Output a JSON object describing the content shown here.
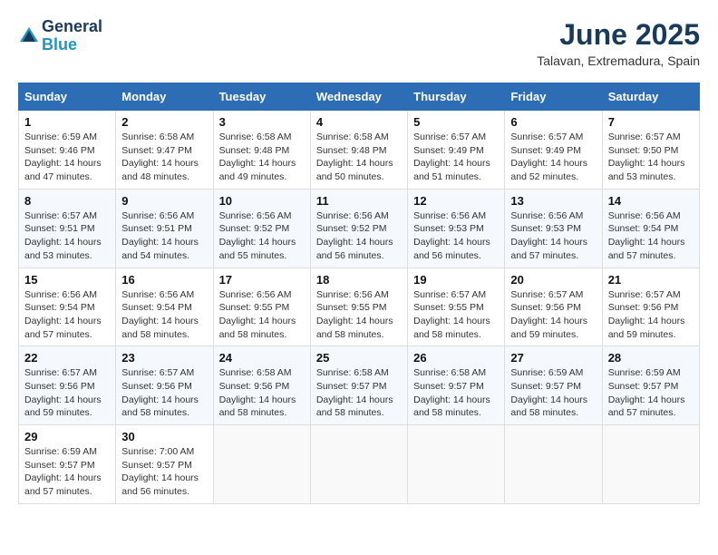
{
  "header": {
    "logo_line1": "General",
    "logo_line2": "Blue",
    "month_year": "June 2025",
    "location": "Talavan, Extremadura, Spain"
  },
  "calendar": {
    "days_of_week": [
      "Sunday",
      "Monday",
      "Tuesday",
      "Wednesday",
      "Thursday",
      "Friday",
      "Saturday"
    ],
    "weeks": [
      [
        {
          "day": "1",
          "sunrise": "6:59 AM",
          "sunset": "9:46 PM",
          "daylight": "14 hours and 47 minutes."
        },
        {
          "day": "2",
          "sunrise": "6:58 AM",
          "sunset": "9:47 PM",
          "daylight": "14 hours and 48 minutes."
        },
        {
          "day": "3",
          "sunrise": "6:58 AM",
          "sunset": "9:48 PM",
          "daylight": "14 hours and 49 minutes."
        },
        {
          "day": "4",
          "sunrise": "6:58 AM",
          "sunset": "9:48 PM",
          "daylight": "14 hours and 50 minutes."
        },
        {
          "day": "5",
          "sunrise": "6:57 AM",
          "sunset": "9:49 PM",
          "daylight": "14 hours and 51 minutes."
        },
        {
          "day": "6",
          "sunrise": "6:57 AM",
          "sunset": "9:49 PM",
          "daylight": "14 hours and 52 minutes."
        },
        {
          "day": "7",
          "sunrise": "6:57 AM",
          "sunset": "9:50 PM",
          "daylight": "14 hours and 53 minutes."
        }
      ],
      [
        {
          "day": "8",
          "sunrise": "6:57 AM",
          "sunset": "9:51 PM",
          "daylight": "14 hours and 53 minutes."
        },
        {
          "day": "9",
          "sunrise": "6:56 AM",
          "sunset": "9:51 PM",
          "daylight": "14 hours and 54 minutes."
        },
        {
          "day": "10",
          "sunrise": "6:56 AM",
          "sunset": "9:52 PM",
          "daylight": "14 hours and 55 minutes."
        },
        {
          "day": "11",
          "sunrise": "6:56 AM",
          "sunset": "9:52 PM",
          "daylight": "14 hours and 56 minutes."
        },
        {
          "day": "12",
          "sunrise": "6:56 AM",
          "sunset": "9:53 PM",
          "daylight": "14 hours and 56 minutes."
        },
        {
          "day": "13",
          "sunrise": "6:56 AM",
          "sunset": "9:53 PM",
          "daylight": "14 hours and 57 minutes."
        },
        {
          "day": "14",
          "sunrise": "6:56 AM",
          "sunset": "9:54 PM",
          "daylight": "14 hours and 57 minutes."
        }
      ],
      [
        {
          "day": "15",
          "sunrise": "6:56 AM",
          "sunset": "9:54 PM",
          "daylight": "14 hours and 57 minutes."
        },
        {
          "day": "16",
          "sunrise": "6:56 AM",
          "sunset": "9:54 PM",
          "daylight": "14 hours and 58 minutes."
        },
        {
          "day": "17",
          "sunrise": "6:56 AM",
          "sunset": "9:55 PM",
          "daylight": "14 hours and 58 minutes."
        },
        {
          "day": "18",
          "sunrise": "6:56 AM",
          "sunset": "9:55 PM",
          "daylight": "14 hours and 58 minutes."
        },
        {
          "day": "19",
          "sunrise": "6:57 AM",
          "sunset": "9:55 PM",
          "daylight": "14 hours and 58 minutes."
        },
        {
          "day": "20",
          "sunrise": "6:57 AM",
          "sunset": "9:56 PM",
          "daylight": "14 hours and 59 minutes."
        },
        {
          "day": "21",
          "sunrise": "6:57 AM",
          "sunset": "9:56 PM",
          "daylight": "14 hours and 59 minutes."
        }
      ],
      [
        {
          "day": "22",
          "sunrise": "6:57 AM",
          "sunset": "9:56 PM",
          "daylight": "14 hours and 59 minutes."
        },
        {
          "day": "23",
          "sunrise": "6:57 AM",
          "sunset": "9:56 PM",
          "daylight": "14 hours and 58 minutes."
        },
        {
          "day": "24",
          "sunrise": "6:58 AM",
          "sunset": "9:56 PM",
          "daylight": "14 hours and 58 minutes."
        },
        {
          "day": "25",
          "sunrise": "6:58 AM",
          "sunset": "9:57 PM",
          "daylight": "14 hours and 58 minutes."
        },
        {
          "day": "26",
          "sunrise": "6:58 AM",
          "sunset": "9:57 PM",
          "daylight": "14 hours and 58 minutes."
        },
        {
          "day": "27",
          "sunrise": "6:59 AM",
          "sunset": "9:57 PM",
          "daylight": "14 hours and 58 minutes."
        },
        {
          "day": "28",
          "sunrise": "6:59 AM",
          "sunset": "9:57 PM",
          "daylight": "14 hours and 57 minutes."
        }
      ],
      [
        {
          "day": "29",
          "sunrise": "6:59 AM",
          "sunset": "9:57 PM",
          "daylight": "14 hours and 57 minutes."
        },
        {
          "day": "30",
          "sunrise": "7:00 AM",
          "sunset": "9:57 PM",
          "daylight": "14 hours and 56 minutes."
        },
        null,
        null,
        null,
        null,
        null
      ]
    ]
  }
}
